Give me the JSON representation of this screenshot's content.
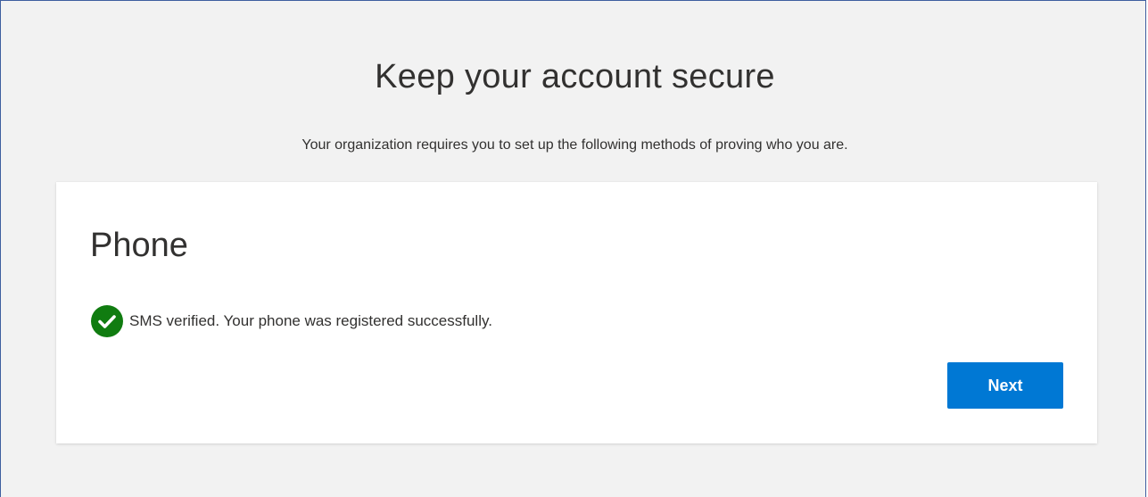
{
  "page": {
    "title": "Keep your account secure",
    "subtitle": "Your organization requires you to set up the following methods of proving who you are."
  },
  "card": {
    "title": "Phone",
    "status_icon": "check-circle-icon",
    "status_color": "#107c10",
    "status_text": "SMS verified. Your phone was registered successfully.",
    "next_label": "Next"
  },
  "colors": {
    "background": "#f2f2f2",
    "card": "#ffffff",
    "primary_button": "#0078d4",
    "text": "#323130",
    "frame_border": "#3f5f9f"
  }
}
